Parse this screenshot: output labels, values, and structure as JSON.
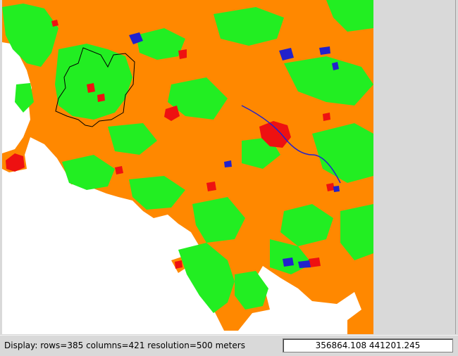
{
  "statusbar": {
    "display_info": "Display: rows=385 columns=421  resolution=500 meters",
    "coordinates": "356864.108 441201.245"
  },
  "map": {
    "legend_colors": {
      "cropland": "#ff8800",
      "vegetation": "#22ee22",
      "urban": "#ee1111",
      "water": "#2222cc",
      "nodata": "#ffffff"
    }
  }
}
